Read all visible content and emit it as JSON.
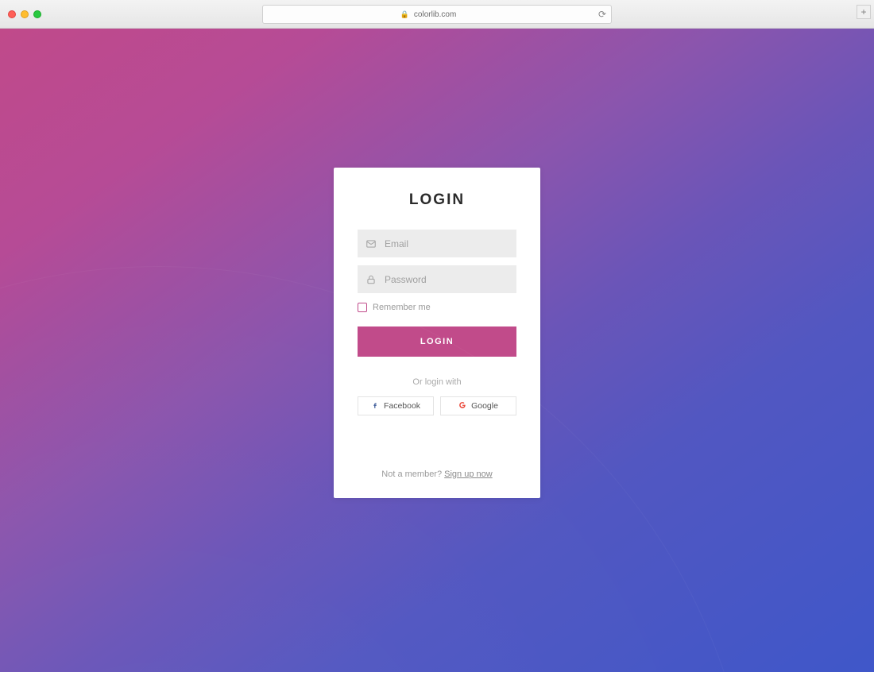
{
  "browser": {
    "url_host": "colorlib.com"
  },
  "card": {
    "title": "LOGIN",
    "email_placeholder": "Email",
    "password_placeholder": "Password",
    "remember_label": "Remember me",
    "submit_label": "LOGIN",
    "divider_text": "Or login with",
    "social": {
      "facebook_label": "Facebook",
      "google_label": "Google"
    },
    "signup_prefix": "Not a member? ",
    "signup_link_label": "Sign up now"
  }
}
